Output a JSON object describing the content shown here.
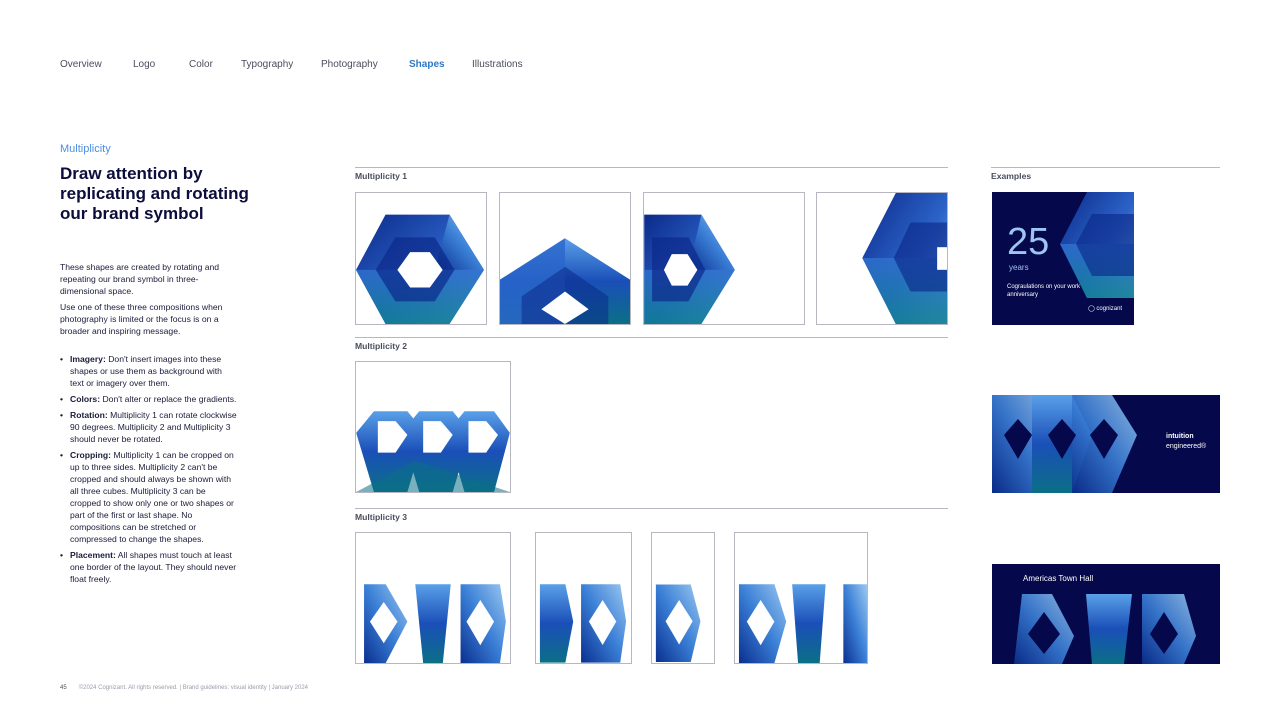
{
  "nav": {
    "items": [
      "Overview",
      "Logo",
      "Color",
      "Typography",
      "Photography",
      "Shapes",
      "Illustrations"
    ],
    "active": "Shapes"
  },
  "intro": {
    "eyebrow": "Multiplicity",
    "headline": "Draw attention by replicating and rotating our brand symbol",
    "paragraph1": "These shapes are created by rotating and repeating our brand symbol in three-dimensional space.",
    "paragraph2": "Use one of these three compositions when photography is limited or the focus is on a broader and inspiring message."
  },
  "rules": [
    {
      "lead": "Imagery:",
      "text": " Don't insert images into these shapes or use them as background with text or imagery over them."
    },
    {
      "lead": "Colors:",
      "text": " Don't alter or replace the gradients."
    },
    {
      "lead": "Rotation:",
      "text": " Multiplicity 1 can rotate clockwise 90 degrees. Multiplicity 2 and Multiplicity 3 should never be rotated."
    },
    {
      "lead": "Cropping:",
      "text": " Multiplicity 1 can be cropped on up to three sides. Multiplicity 2 can't be cropped and should always be shown with all three cubes. Multiplicity 3 can be cropped to show only one or two shapes or part of the first or last shape. No compositions can be stretched or compressed to change the shapes."
    },
    {
      "lead": "Placement:",
      "text": " All shapes must touch at least one border of the layout. They should never float freely."
    }
  ],
  "sections": {
    "m1": "Multiplicity 1",
    "m2": "Multiplicity 2",
    "m3": "Multiplicity 3",
    "examples": "Examples"
  },
  "examples": {
    "anniversary": {
      "number": "25",
      "unit": "years",
      "message": "Cograulations on your work anniversary",
      "logo": "cognizant"
    },
    "tagline": {
      "line1": "intuition",
      "line2": "engineered®"
    },
    "townhall": {
      "title": "Americas Town Hall"
    }
  },
  "footer": {
    "page": "45",
    "text": "©2024 Cognizant. All rights reserved.  |  Brand guidelines: visual identity  |  January 2024"
  },
  "colors": {
    "navy": "#05084a",
    "deep_blue": "#0b2a8a",
    "mid_blue": "#2c63c8",
    "light_blue": "#7fb3ea",
    "teal": "#127c8f",
    "accent_text": "#2f78c4"
  }
}
